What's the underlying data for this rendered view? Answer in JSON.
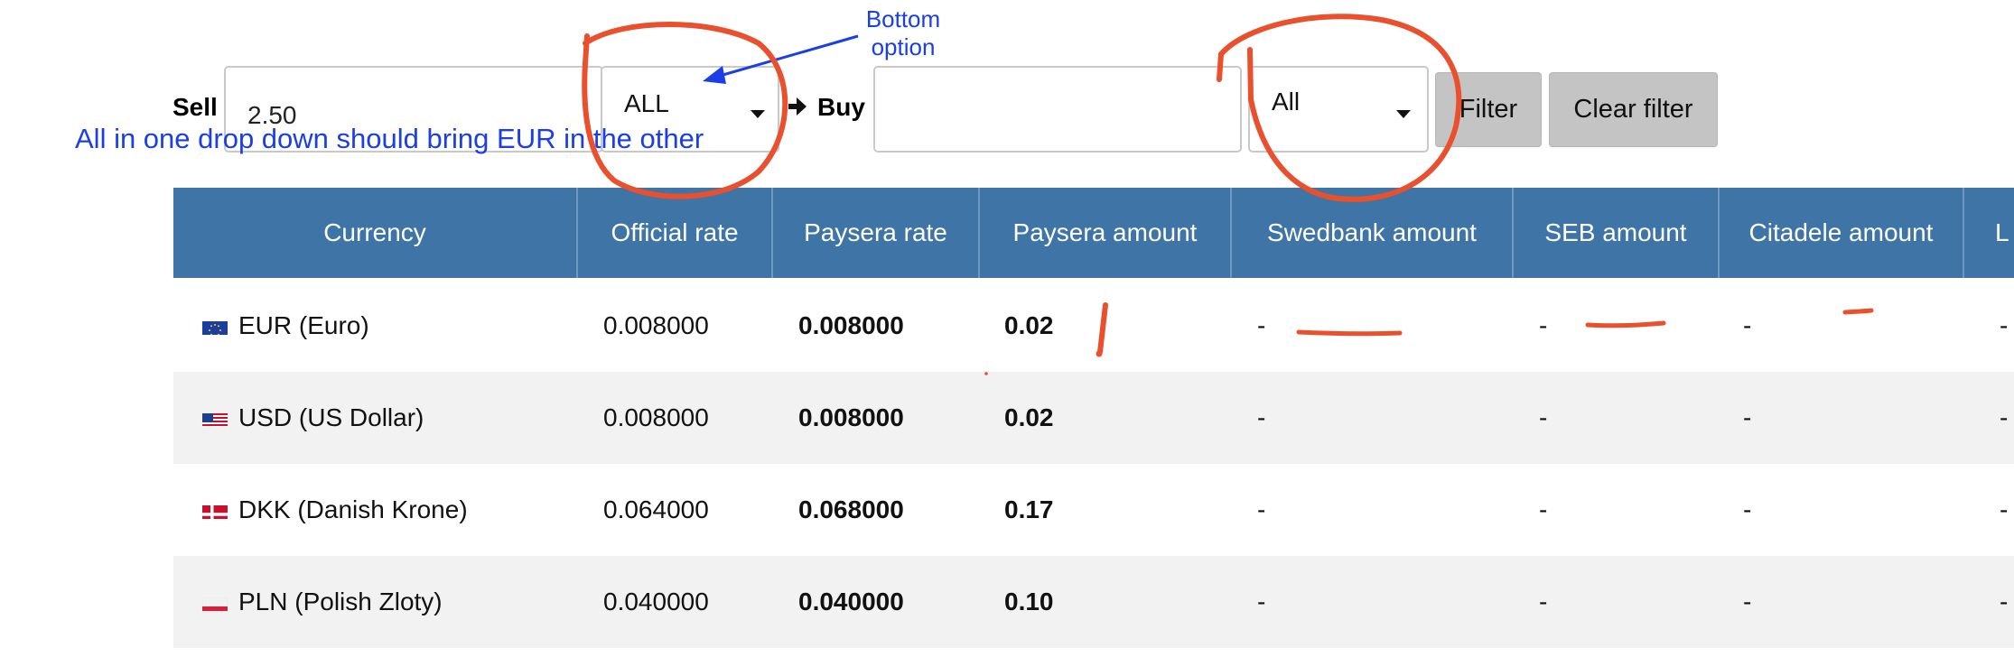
{
  "filter": {
    "sell_label": "Sell",
    "sell_value": "2.50",
    "sell_currency": "ALL",
    "buy_label": "Buy",
    "buy_value": "",
    "buy_currency": "All",
    "filter_button": "Filter",
    "clear_button": "Clear filter"
  },
  "table": {
    "headers": [
      "Currency",
      "Official rate",
      "Paysera rate",
      "Paysera amount",
      "Swedbank amount",
      "SEB amount",
      "Citadele amount",
      "L"
    ],
    "rows": [
      {
        "flag": "eu-flag-icon",
        "currency": "EUR (Euro)",
        "official": "0.008000",
        "paysera_rate": "0.008000",
        "paysera_amount": "0.02",
        "swedbank": "-",
        "seb": "-",
        "citadele": "-",
        "l": "-"
      },
      {
        "flag": "us-flag-icon",
        "currency": "USD (US Dollar)",
        "official": "0.008000",
        "paysera_rate": "0.008000",
        "paysera_amount": "0.02",
        "swedbank": "-",
        "seb": "-",
        "citadele": "-",
        "l": "-"
      },
      {
        "flag": "dk-flag-icon",
        "currency": "DKK (Danish Krone)",
        "official": "0.064000",
        "paysera_rate": "0.068000",
        "paysera_amount": "0.17",
        "swedbank": "-",
        "seb": "-",
        "citadele": "-",
        "l": "-"
      },
      {
        "flag": "pl-flag-icon",
        "currency": "PLN (Polish Zloty)",
        "official": "0.040000",
        "paysera_rate": "0.040000",
        "paysera_amount": "0.10",
        "swedbank": "-",
        "seb": "-",
        "citadele": "-",
        "l": "-"
      }
    ]
  },
  "annotations": {
    "bottom_option_note": [
      "Bottom",
      "option"
    ],
    "instruction_note": "All in one drop down should bring EUR in the other",
    "exclamation": "!",
    "blue_color": "#1a3ee8",
    "red_color": "#e8502e"
  }
}
